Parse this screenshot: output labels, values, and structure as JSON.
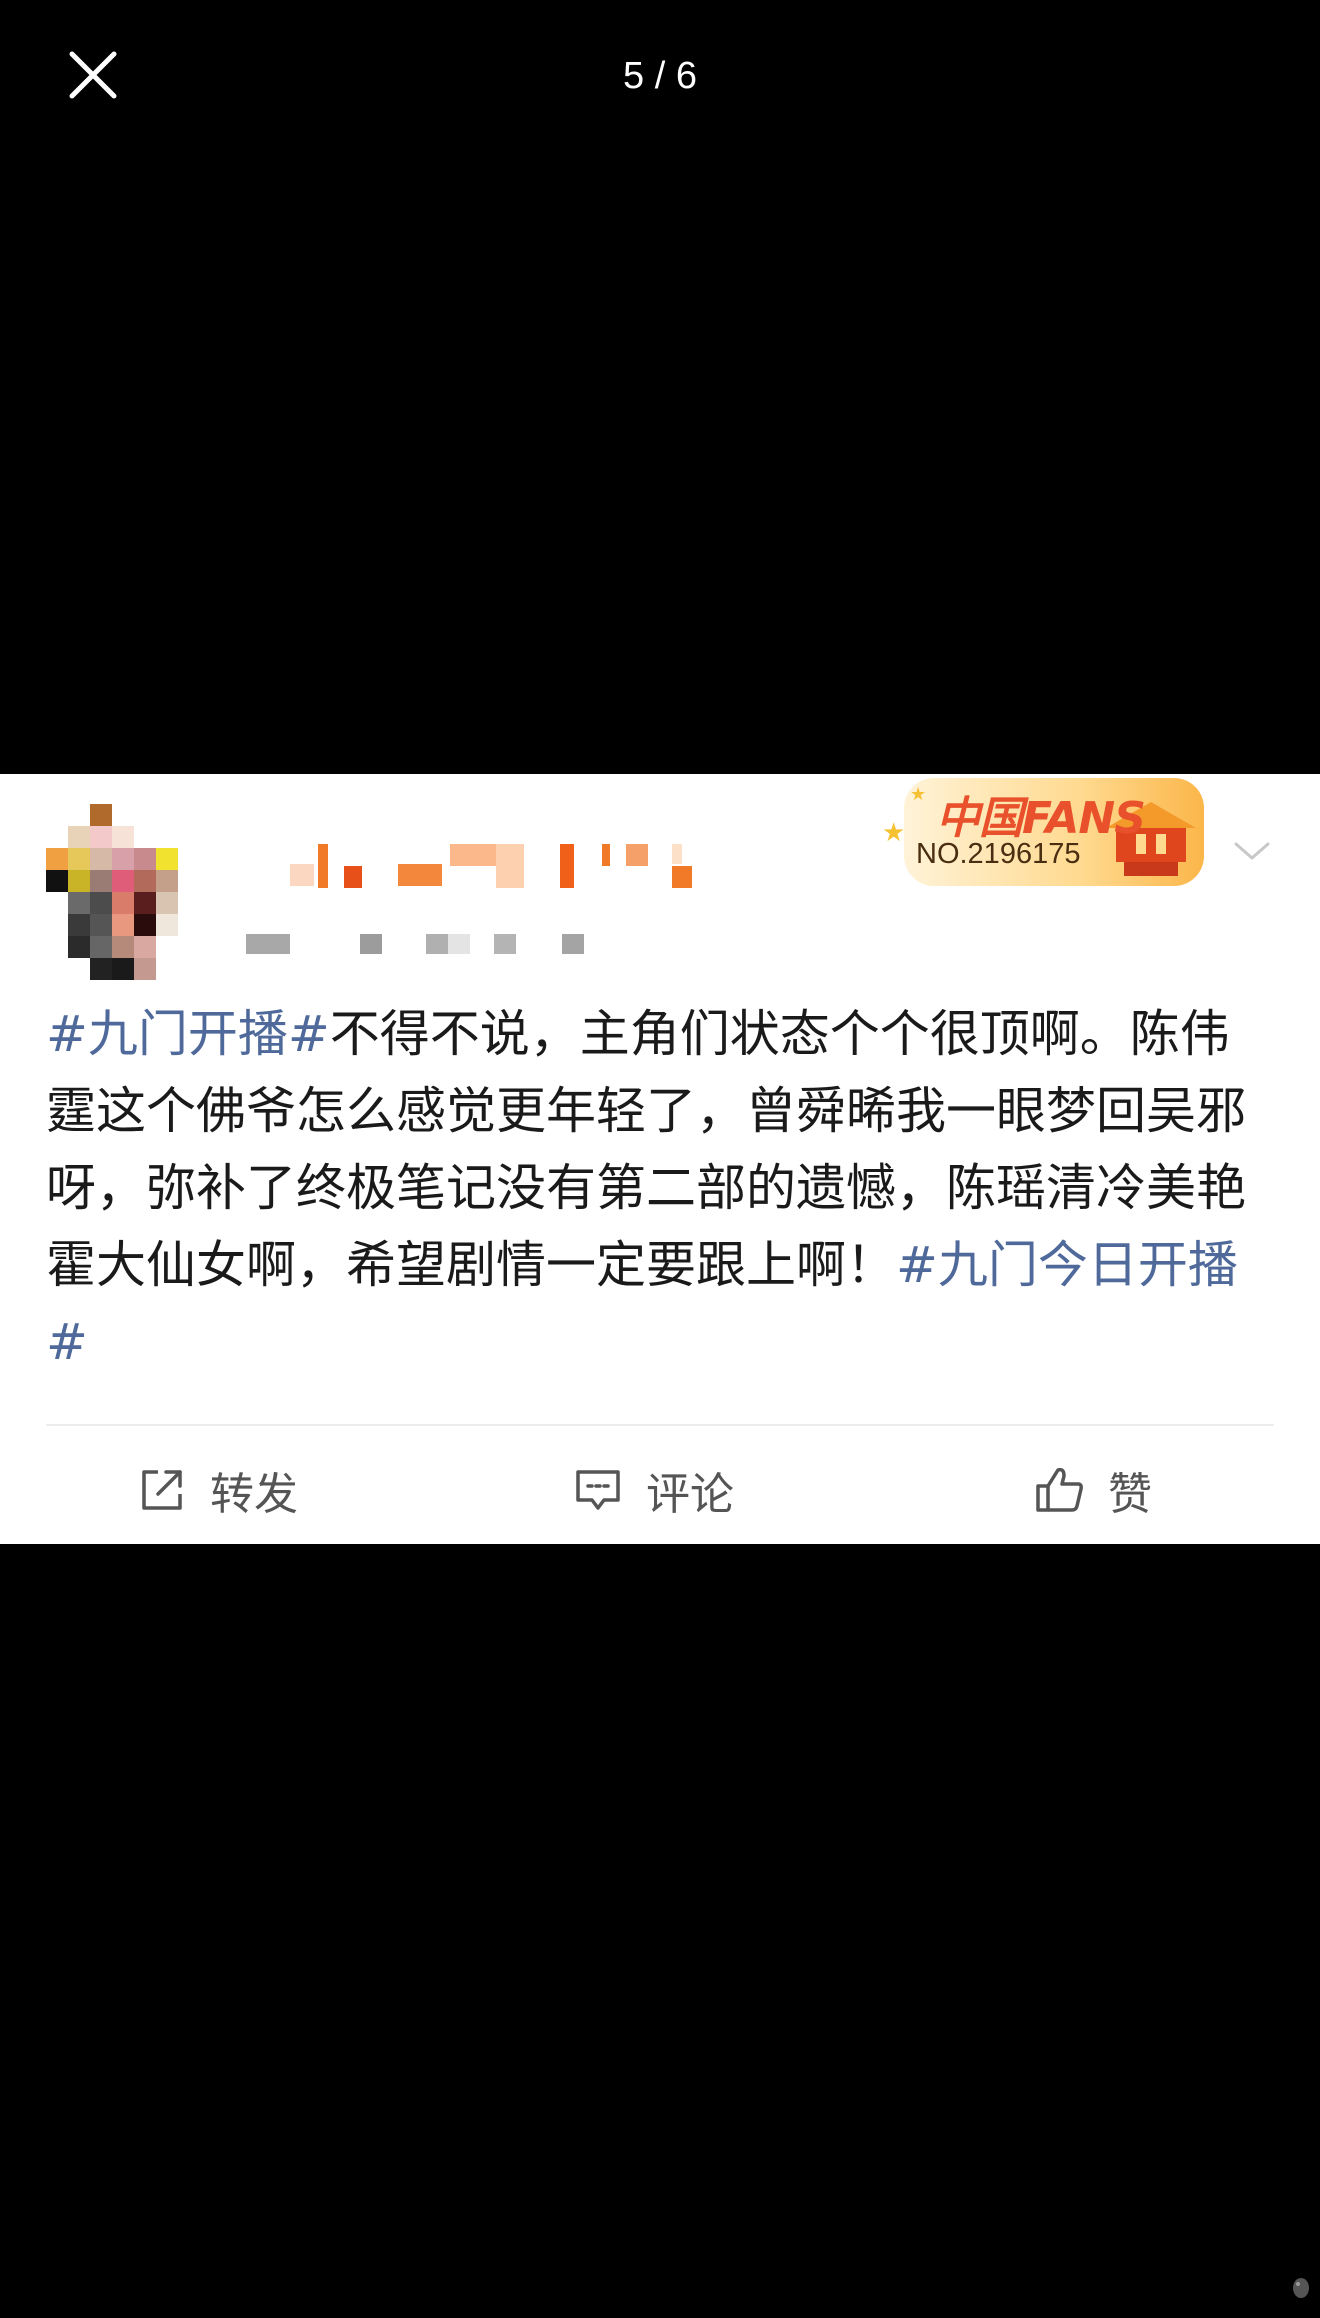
{
  "viewer": {
    "counter": "5 / 6",
    "close_icon": "close-icon"
  },
  "post": {
    "username_obscured": "",
    "badge": {
      "title": "中国FANS",
      "number": "NO.2196175"
    },
    "text_segments": [
      {
        "type": "tag",
        "text": "#九门开播#"
      },
      {
        "type": "text",
        "text": "不得不说，主角们状态个个很顶啊。陈伟霆这个佛爷怎么感觉更年轻了，曾舜晞我一眼梦回吴邪呀，弥补了终极笔记没有第二部的遗憾，陈瑶清冷美艳霍大仙女啊，希望剧情一定要跟上啊！"
      },
      {
        "type": "tag",
        "text": "#九门今日开播#"
      }
    ],
    "actions": {
      "repost": "转发",
      "comment": "评论",
      "like": "赞"
    }
  },
  "colors": {
    "background": "#000000",
    "card": "#ffffff",
    "tag": "#4f6a9a",
    "text": "#1a1a1a",
    "badge_red": "#e8512b"
  }
}
